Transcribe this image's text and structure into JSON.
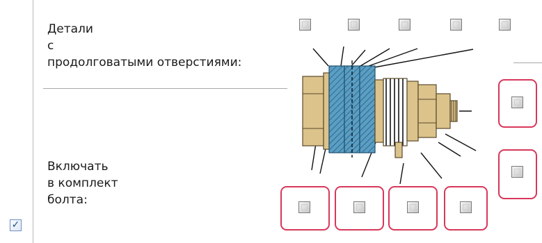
{
  "labels": {
    "details": "Детали\nс\nпродолговатыми отверстиями:",
    "include": "Включать\nв комплект\nболта:"
  },
  "checkboxes": {
    "top_row": [
      false,
      false,
      false,
      false,
      false
    ],
    "right_column": [
      false,
      false
    ],
    "bottom_row": [
      false,
      false,
      false,
      false
    ],
    "corner": true
  },
  "icons": {
    "diagram": "bolt-assembly-diagram",
    "check_glyph": "✓"
  },
  "colors": {
    "highlight": "#d8375a",
    "washer_blue": "#5a9ec4",
    "part_tan": "#dcc38c"
  }
}
